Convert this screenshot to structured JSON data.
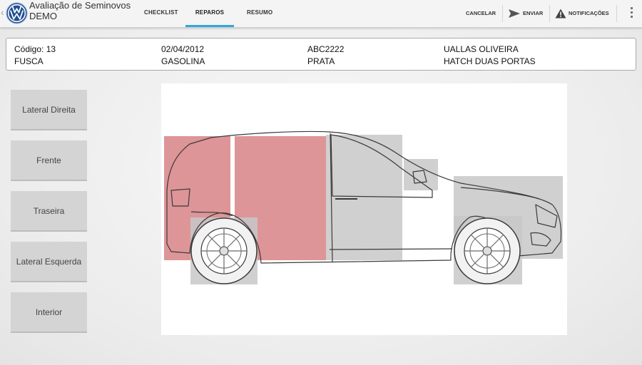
{
  "app": {
    "title": "Avaliação de Seminovos",
    "subtitle": "DEMO",
    "logo_icon": "volkswagen-logo",
    "back_icon": "up-caret-icon"
  },
  "tabs": [
    {
      "label": "CHECKLIST",
      "active": false
    },
    {
      "label": "REPAROS",
      "active": true
    },
    {
      "label": "RESUMO",
      "active": false
    }
  ],
  "actions": {
    "cancel_label": "CANCELAR",
    "send_label": "ENVIAR",
    "send_icon": "send-icon",
    "notifications_label": "NOTIFICAÇÕES",
    "notifications_icon": "warning-icon",
    "overflow_icon": "overflow-menu-icon"
  },
  "vehicle": {
    "code": "Código: 13",
    "date": "02/04/2012",
    "plate": "ABC2222",
    "owner": "UALLAS OLIVEIRA",
    "model": "FUSCA",
    "fuel": "GASOLINA",
    "color": "PRATA",
    "body": "HATCH DUAS PORTAS"
  },
  "views": [
    {
      "label": "Lateral Direita"
    },
    {
      "label": "Frente"
    },
    {
      "label": "Traseira"
    },
    {
      "label": "Lateral Esquerda"
    },
    {
      "label": "Interior"
    }
  ],
  "car_regions": [
    {
      "name": "rear-quarter",
      "status": "damaged"
    },
    {
      "name": "rear-side-panel",
      "status": "damaged"
    },
    {
      "name": "door",
      "status": "unselected"
    },
    {
      "name": "mirror",
      "status": "unselected"
    },
    {
      "name": "front-fender",
      "status": "unselected"
    },
    {
      "name": "rear-wheel",
      "status": "unselected"
    },
    {
      "name": "front-wheel",
      "status": "unselected"
    }
  ],
  "colors": {
    "accent": "#33a6d8",
    "damaged": "#d9898c",
    "unselected": "#c8c8c8"
  }
}
